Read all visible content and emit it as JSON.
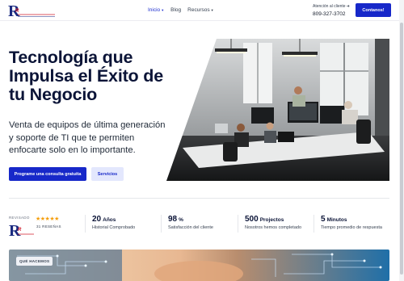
{
  "header": {
    "nav": [
      {
        "label": "Inicio",
        "has_caret": true,
        "active": true
      },
      {
        "label": "Blog",
        "has_caret": false,
        "active": false
      },
      {
        "label": "Recursos",
        "has_caret": true,
        "active": false
      }
    ],
    "contact_label": "Atención al cliente",
    "phone": "809-327-3702",
    "cta": "Contanos!"
  },
  "hero": {
    "title_lines": [
      "Tecnología que",
      "Impulsa el Éxito de",
      "tu Negocio"
    ],
    "subtitle_lines": [
      "Venta de equipos de última generación",
      "y soporte de TI que te permiten",
      "enfocarte solo en lo importante."
    ],
    "primary_button": "Programe una consulta gratuita",
    "secondary_button": "Servicios"
  },
  "stats_bar": {
    "reviewed_label": "REVISADO",
    "reviews_count": "31 RESEÑAS",
    "stars": "★★★★★",
    "items": [
      {
        "number": "20",
        "unit": "Años",
        "label": "Historial Comprobado"
      },
      {
        "number": "98",
        "unit": "%",
        "label": "Satisfacción del cliente"
      },
      {
        "number": "500",
        "unit": "Projectos",
        "label": "Nosotros hemos completado"
      },
      {
        "number": "5",
        "unit": "Minutos",
        "label": "Tiempo promedio de respuesta"
      }
    ]
  },
  "banner": {
    "badge": "QUÉ HACEMOS"
  },
  "colors": {
    "brand_blue": "#1728c9",
    "title_navy": "#0b1437",
    "star": "#f59e0b"
  },
  "icons": [
    "logo",
    "chevron-down-icon",
    "arrow-right-icon",
    "star-icon"
  ]
}
